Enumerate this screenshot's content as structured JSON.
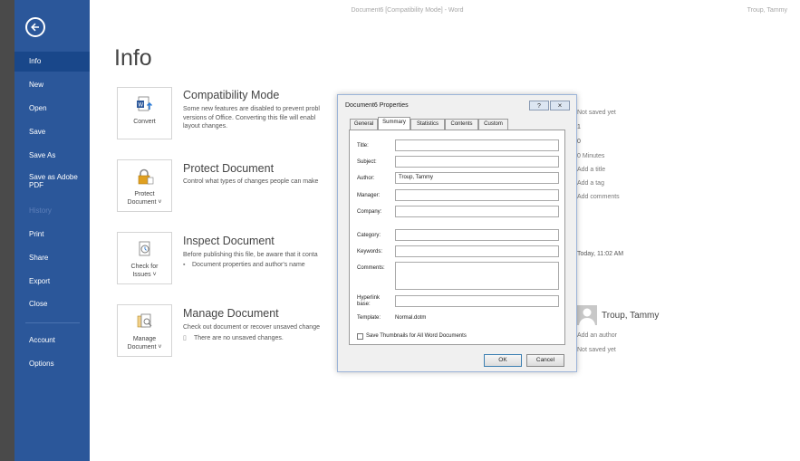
{
  "window": {
    "title": "Document6 [Compatibility Mode] - Word",
    "user": "Troup, Tammy"
  },
  "nav": {
    "items": [
      {
        "label": "Info",
        "active": true
      },
      {
        "label": "New"
      },
      {
        "label": "Open"
      },
      {
        "label": "Save"
      },
      {
        "label": "Save As"
      },
      {
        "label": "Save as Adobe PDF"
      },
      {
        "label": "History",
        "disabled": true
      },
      {
        "label": "Print"
      },
      {
        "label": "Share"
      },
      {
        "label": "Export"
      },
      {
        "label": "Close"
      },
      {
        "label": "Account"
      },
      {
        "label": "Options"
      }
    ]
  },
  "page": {
    "title": "Info"
  },
  "sections": {
    "compat": {
      "button": "Convert",
      "title": "Compatibility Mode",
      "desc": [
        "Some new features are disabled to prevent probl",
        "versions of Office. Converting this file will enabl",
        "layout changes."
      ]
    },
    "protect": {
      "button": [
        "Protect",
        "Document ˅"
      ],
      "title": "Protect Document",
      "desc": [
        "Control what types of changes people can make"
      ]
    },
    "inspect": {
      "button": [
        "Check for",
        "Issues ˅"
      ],
      "title": "Inspect Document",
      "desc": [
        "Before publishing this file, be aware that it conta"
      ],
      "bullet": "Document properties and author's name"
    },
    "manage": {
      "button": [
        "Manage",
        "Document ˅"
      ],
      "title": "Manage Document",
      "desc": [
        "Check out document or recover unsaved change"
      ],
      "bullet": "There are no unsaved changes."
    }
  },
  "properties": {
    "values": [
      "Not saved yet",
      "1",
      "0",
      "0 Minutes",
      "Add a title",
      "Add a tag",
      "Add comments"
    ],
    "date": "Today, 11:02 AM",
    "author": "Troup, Tammy",
    "add_author": "Add an author",
    "last_modified_by": "Not saved yet"
  },
  "dialog": {
    "title": "Document6 Properties",
    "help": "?",
    "close": "×",
    "tabs": [
      "General",
      "Summary",
      "Statistics",
      "Contents",
      "Custom"
    ],
    "active_tab": "Summary",
    "fields": {
      "title": {
        "label": "Title:",
        "value": ""
      },
      "subject": {
        "label": "Subject:",
        "value": ""
      },
      "author": {
        "label": "Author:",
        "value": "Troup, Tammy"
      },
      "manager": {
        "label": "Manager:",
        "value": ""
      },
      "company": {
        "label": "Company:",
        "value": ""
      },
      "category": {
        "label": "Category:",
        "value": ""
      },
      "keywords": {
        "label": "Keywords:",
        "value": ""
      },
      "comments": {
        "label": "Comments:",
        "value": ""
      },
      "hyperlink": {
        "label": "Hyperlink base:",
        "label1": "Hyperlink",
        "label2": "base:",
        "value": ""
      },
      "template": {
        "label": "Template:",
        "value": "Normal.dotm"
      }
    },
    "checkbox": {
      "label": "Save Thumbnails for All Word Documents",
      "checked": false
    },
    "ok": "OK",
    "cancel": "Cancel"
  },
  "colors": {
    "nav_bg": "#2b579a",
    "nav_active": "#19478a",
    "chrome": "#4a4a4a",
    "accent": "#2b579a"
  }
}
